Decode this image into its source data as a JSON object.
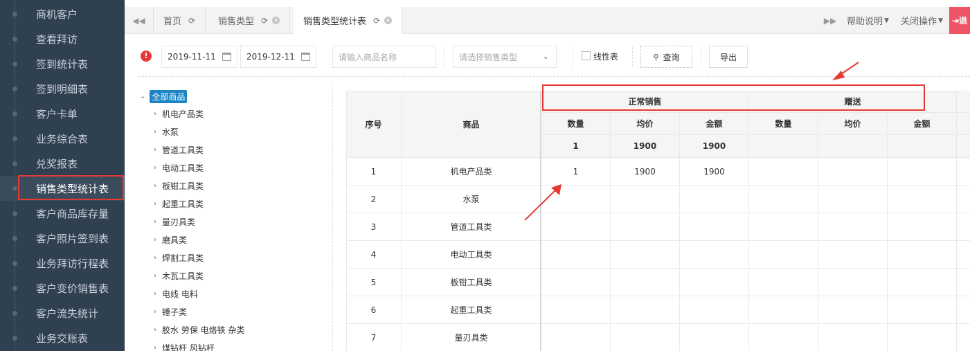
{
  "sidebar": {
    "items": [
      {
        "label": "商机客户"
      },
      {
        "label": "查看拜访"
      },
      {
        "label": "签到统计表"
      },
      {
        "label": "签到明细表"
      },
      {
        "label": "客户卡单"
      },
      {
        "label": "业务综合表"
      },
      {
        "label": "兑奖报表"
      },
      {
        "label": "销售类型统计表",
        "active": true
      },
      {
        "label": "客户商品库存量"
      },
      {
        "label": "客户照片签到表"
      },
      {
        "label": "业务拜访行程表"
      },
      {
        "label": "客户变价销售表"
      },
      {
        "label": "客户流失统计"
      },
      {
        "label": "业务交账表"
      }
    ]
  },
  "tabs": [
    {
      "label": "首页"
    },
    {
      "label": "销售类型"
    },
    {
      "label": "销售类型统计表"
    }
  ],
  "topbar": {
    "help": "帮助说明",
    "close_ops": "关闭操作",
    "exit_label": "退"
  },
  "filters": {
    "date_start": "2019-11-11",
    "date_end": "2019-12-11",
    "product_placeholder": "请输入商品名称",
    "sales_type_placeholder": "请选择销售类型",
    "linear_label": "线性表",
    "search_label": "查询",
    "export_label": "导出"
  },
  "tree": {
    "root": "全部商品",
    "nodes": [
      "机电产品类",
      "水泵",
      "管道工具类",
      "电动工具类",
      "板钳工具类",
      "起重工具类",
      "量刃具类",
      "磨具类",
      "焊割工具类",
      "木瓦工具类",
      "电线 电料",
      "锤子类",
      "胶水 劳保 电烙铁 杂类",
      "煤钻杆 风钻杆"
    ]
  },
  "table": {
    "headers": {
      "seq": "序号",
      "product": "商品",
      "group_normal": "正常销售",
      "group_gift": "赠送",
      "qty": "数量",
      "avg_price": "均价",
      "amount": "金额"
    },
    "totals": {
      "qty": "1",
      "avg": "1900",
      "amount": "1900"
    },
    "rows": [
      {
        "seq": "1",
        "product": "机电产品类",
        "qty": "1",
        "avg": "1900",
        "amount": "1900"
      },
      {
        "seq": "2",
        "product": "水泵",
        "qty": "",
        "avg": "",
        "amount": ""
      },
      {
        "seq": "3",
        "product": "管道工具类",
        "qty": "",
        "avg": "",
        "amount": ""
      },
      {
        "seq": "4",
        "product": "电动工具类",
        "qty": "",
        "avg": "",
        "amount": ""
      },
      {
        "seq": "5",
        "product": "板钳工具类",
        "qty": "",
        "avg": "",
        "amount": ""
      },
      {
        "seq": "6",
        "product": "起重工具类",
        "qty": "",
        "avg": "",
        "amount": ""
      },
      {
        "seq": "7",
        "product": "量刃具类",
        "qty": "",
        "avg": "",
        "amount": ""
      }
    ]
  },
  "colors": {
    "sidebar_bg": "#2f4050",
    "accent_blue": "#1c84c6",
    "annotation_red": "#e53935",
    "exit_red": "#ed5565"
  }
}
